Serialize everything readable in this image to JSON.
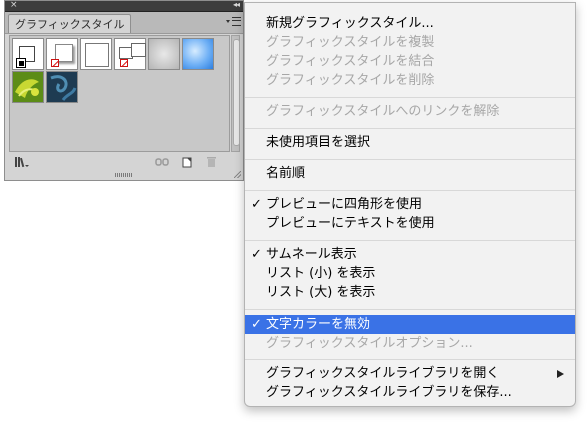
{
  "panel": {
    "tab_title": "グラフィックスタイル",
    "close_glyph": "×",
    "collapse_glyph": "◂◂",
    "icons": {
      "library": "library-menu-icon",
      "break_link": "break-link-icon",
      "new": "new-style-icon",
      "delete": "delete-icon"
    },
    "colors": {
      "titlebar": "#3d3d3d",
      "panel_bg": "#d4d4d4",
      "content_bg": "#c8c8c8"
    },
    "swatches": [
      {
        "kind": "default-style"
      },
      {
        "kind": "drop-shadow-none"
      },
      {
        "kind": "plain-white"
      },
      {
        "kind": "none-with-frame"
      },
      {
        "kind": "soft-shadow"
      },
      {
        "kind": "blue-glow"
      },
      {
        "kind": "green-pattern"
      },
      {
        "kind": "blue-pattern"
      }
    ]
  },
  "menu": {
    "items": [
      {
        "label": "新規グラフィックスタイル...",
        "enabled": true,
        "checked": false
      },
      {
        "label": "グラフィックスタイルを複製",
        "enabled": false,
        "checked": false
      },
      {
        "label": "グラフィックスタイルを結合",
        "enabled": false,
        "checked": false
      },
      {
        "label": "グラフィックスタイルを削除",
        "enabled": false,
        "checked": false
      },
      {
        "label": "グラフィックスタイルへのリンクを解除",
        "enabled": false,
        "checked": false
      },
      {
        "label": "未使用項目を選択",
        "enabled": true,
        "checked": false
      },
      {
        "label": "名前順",
        "enabled": true,
        "checked": false
      },
      {
        "label": "プレビューに四角形を使用",
        "enabled": true,
        "checked": true
      },
      {
        "label": "プレビューにテキストを使用",
        "enabled": true,
        "checked": false
      },
      {
        "label": "サムネール表示",
        "enabled": true,
        "checked": true
      },
      {
        "label": "リスト (小) を表示",
        "enabled": true,
        "checked": false
      },
      {
        "label": "リスト (大) を表示",
        "enabled": true,
        "checked": false
      },
      {
        "label": "文字カラーを無効",
        "enabled": true,
        "checked": true,
        "highlighted": true
      },
      {
        "label": "グラフィックスタイルオプション...",
        "enabled": false,
        "checked": false
      },
      {
        "label": "グラフィックスタイルライブラリを開く",
        "enabled": true,
        "checked": false,
        "submenu": true
      },
      {
        "label": "グラフィックスタイルライブラリを保存...",
        "enabled": true,
        "checked": false
      }
    ],
    "check_glyph": "✓",
    "colors": {
      "highlight": "#3a72e6",
      "disabled_text": "#a7a7a7"
    }
  }
}
